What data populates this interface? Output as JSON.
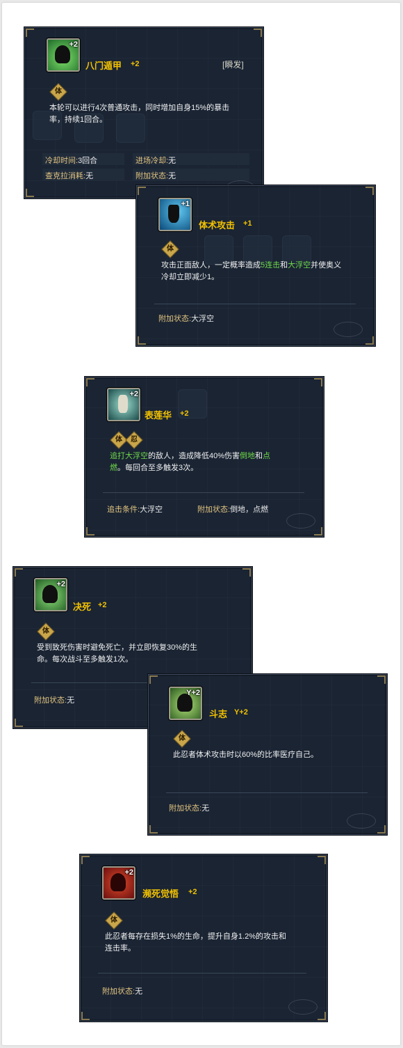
{
  "cards": [
    {
      "name": "八门遁甲",
      "level": "+2",
      "type": "[瞬发]",
      "icon_badge": "+2",
      "icon_colors": [
        "#1f6a2a",
        "#7fe36a"
      ],
      "tags": [
        "体"
      ],
      "desc": "本轮可以进行4次普通攻击，同时增加自身15%的暴击率，持续1回合。",
      "stats": [
        {
          "label": "冷却时间:",
          "value": "3回合"
        },
        {
          "label": "进场冷却:",
          "value": "无"
        },
        {
          "label": "查克拉消耗:",
          "value": "无"
        },
        {
          "label": "附加状态:",
          "value": "无"
        }
      ]
    },
    {
      "name": "体术攻击",
      "level": "+1",
      "icon_badge": "+1",
      "icon_colors": [
        "#0a4a7a",
        "#5fc6f0"
      ],
      "tags": [
        "体"
      ],
      "desc_parts": [
        "攻击正面敌人，一定概率造成",
        "5连击",
        "和",
        "大浮空",
        "并使奥义冷却立即减少1。"
      ],
      "stats": [
        {
          "label": "附加状态:",
          "value": "大浮空"
        }
      ]
    },
    {
      "name": "表莲华",
      "level": "+2",
      "icon_badge": "+2",
      "icon_colors": [
        "#1a4a4a",
        "#9fe0d0"
      ],
      "tags": [
        "体",
        "忍"
      ],
      "desc_parts": [
        "追打大浮空",
        "的敌人，造成降低40%伤害",
        "倒地",
        "和",
        "点燃",
        "。每回合至多触发3次。"
      ],
      "stats": [
        {
          "label": "追击条件:",
          "value": "大浮空"
        },
        {
          "label": "附加状态:",
          "value": "倒地，点燃"
        }
      ]
    },
    {
      "name": "决死",
      "level": "+2",
      "icon_badge": "+2",
      "icon_colors": [
        "#1f5a22",
        "#8ee07a"
      ],
      "tags": [
        "体"
      ],
      "desc": "受到致死伤害时避免死亡，并立即恢复30%的生命。每次战斗至多触发1次。",
      "stats": [
        {
          "label": "附加状态:",
          "value": "无"
        }
      ]
    },
    {
      "name": "斗志",
      "level": "Y+2",
      "icon_badge": "Y+2",
      "icon_colors": [
        "#2a5a1f",
        "#b4e37a"
      ],
      "tags": [
        "体"
      ],
      "desc": "此忍者体术攻击时以60%的比率医疗自己。",
      "stats": [
        {
          "label": "附加状态:",
          "value": "无"
        }
      ]
    },
    {
      "name": "濒死觉悟",
      "level": "+2",
      "icon_badge": "+2",
      "icon_colors": [
        "#6a0f0f",
        "#e04a2a"
      ],
      "tags": [
        "体"
      ],
      "desc": "此忍者每存在损失1%的生命，提升自身1.2%的攻击和连击率。",
      "stats": [
        {
          "label": "附加状态:",
          "value": "无"
        }
      ]
    }
  ],
  "colors": {
    "name": "#f2c200",
    "highlight": "#6fd84a",
    "label": "#e2c480",
    "panel": "#1a2433"
  }
}
